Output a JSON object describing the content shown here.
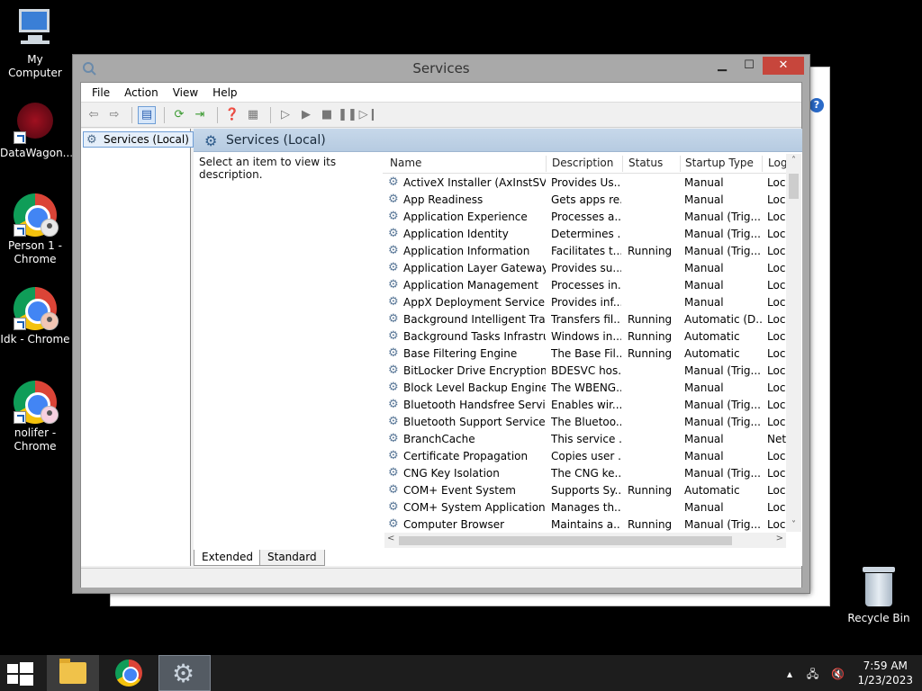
{
  "desktop": {
    "icons": [
      {
        "label": "My Computer"
      },
      {
        "label": "DataWagon..."
      },
      {
        "label": "Person 1 - Chrome"
      },
      {
        "label": "Idk - Chrome"
      },
      {
        "label": "nolifer - Chrome"
      }
    ],
    "recycle_bin": "Recycle Bin"
  },
  "window": {
    "title": "Services",
    "controls": {
      "minimize": "▁",
      "maximize": "☐",
      "close": "✕"
    },
    "menu": [
      "File",
      "Action",
      "View",
      "Help"
    ],
    "tree": {
      "root": "Services (Local)"
    },
    "content_header": "Services (Local)",
    "description_prompt": "Select an item to view its description.",
    "columns": {
      "name": "Name",
      "description": "Description",
      "status": "Status",
      "startup": "Startup Type",
      "log": "Log"
    },
    "services": [
      {
        "name": "ActiveX Installer (AxInstSV)",
        "description": "Provides Us...",
        "status": "",
        "startup": "Manual",
        "log": "Loc"
      },
      {
        "name": "App Readiness",
        "description": "Gets apps re...",
        "status": "",
        "startup": "Manual",
        "log": "Loc"
      },
      {
        "name": "Application Experience",
        "description": "Processes a...",
        "status": "",
        "startup": "Manual (Trig...",
        "log": "Loc"
      },
      {
        "name": "Application Identity",
        "description": "Determines ...",
        "status": "",
        "startup": "Manual (Trig...",
        "log": "Loc"
      },
      {
        "name": "Application Information",
        "description": "Facilitates t...",
        "status": "Running",
        "startup": "Manual (Trig...",
        "log": "Loc"
      },
      {
        "name": "Application Layer Gateway ...",
        "description": "Provides su...",
        "status": "",
        "startup": "Manual",
        "log": "Loc"
      },
      {
        "name": "Application Management",
        "description": "Processes in...",
        "status": "",
        "startup": "Manual",
        "log": "Loc"
      },
      {
        "name": "AppX Deployment Service (...",
        "description": "Provides inf...",
        "status": "",
        "startup": "Manual",
        "log": "Loc"
      },
      {
        "name": "Background Intelligent Tran...",
        "description": "Transfers fil...",
        "status": "Running",
        "startup": "Automatic (D...",
        "log": "Loc"
      },
      {
        "name": "Background Tasks Infrastru...",
        "description": "Windows in...",
        "status": "Running",
        "startup": "Automatic",
        "log": "Loc"
      },
      {
        "name": "Base Filtering Engine",
        "description": "The Base Fil...",
        "status": "Running",
        "startup": "Automatic",
        "log": "Loc"
      },
      {
        "name": "BitLocker Drive Encryption ...",
        "description": "BDESVC hos...",
        "status": "",
        "startup": "Manual (Trig...",
        "log": "Loc"
      },
      {
        "name": "Block Level Backup Engine ...",
        "description": "The WBENG...",
        "status": "",
        "startup": "Manual",
        "log": "Loc"
      },
      {
        "name": "Bluetooth Handsfree Service",
        "description": "Enables wir...",
        "status": "",
        "startup": "Manual (Trig...",
        "log": "Loc"
      },
      {
        "name": "Bluetooth Support Service",
        "description": "The Bluetoo...",
        "status": "",
        "startup": "Manual (Trig...",
        "log": "Loc"
      },
      {
        "name": "BranchCache",
        "description": "This service ...",
        "status": "",
        "startup": "Manual",
        "log": "Net"
      },
      {
        "name": "Certificate Propagation",
        "description": "Copies user ...",
        "status": "",
        "startup": "Manual",
        "log": "Loc"
      },
      {
        "name": "CNG Key Isolation",
        "description": "The CNG ke...",
        "status": "",
        "startup": "Manual (Trig...",
        "log": "Loc"
      },
      {
        "name": "COM+ Event System",
        "description": "Supports Sy...",
        "status": "Running",
        "startup": "Automatic",
        "log": "Loc"
      },
      {
        "name": "COM+ System Application",
        "description": "Manages th...",
        "status": "",
        "startup": "Manual",
        "log": "Loc"
      },
      {
        "name": "Computer Browser",
        "description": "Maintains a...",
        "status": "Running",
        "startup": "Manual (Trig...",
        "log": "Loc"
      }
    ],
    "tabs": [
      "Extended",
      "Standard"
    ]
  },
  "taskbar": {
    "time": "7:59 AM",
    "date": "1/23/2023"
  }
}
